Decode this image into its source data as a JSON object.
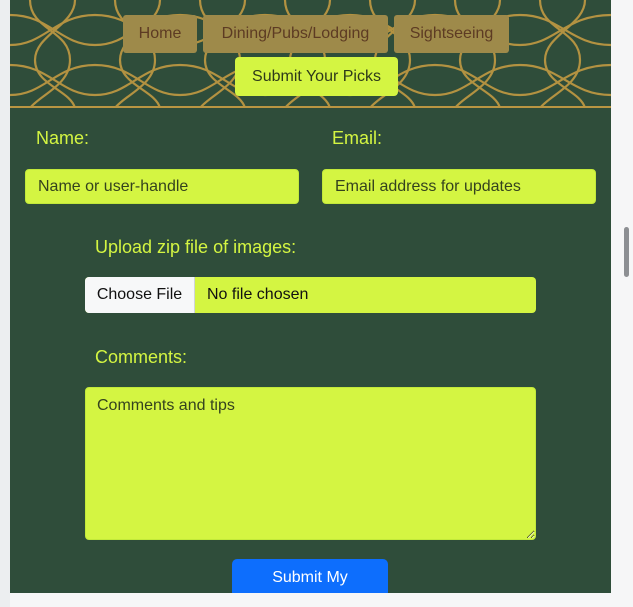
{
  "nav": {
    "home": "Home",
    "dining": "Dining/Pubs/Lodging",
    "sightseeing": "Sightseeing",
    "submit_picks": "Submit Your Picks"
  },
  "form": {
    "name_label": "Name:",
    "email_label": "Email:",
    "name_placeholder": "Name or user-handle",
    "email_placeholder": "Email address for updates",
    "upload_label": "Upload zip file of images:",
    "choose_file": "Choose File",
    "file_status": "No file chosen",
    "comments_label": "Comments:",
    "comments_placeholder": "Comments and tips",
    "submit_button": "Submit My"
  },
  "colors": {
    "background": "#2f4d3a",
    "accent": "#d4f542",
    "nav_button": "#9e8a4a",
    "pattern": "#b99542",
    "submit": "#0d6efd"
  },
  "icons": {
    "pattern": "celtic-knot-pattern"
  }
}
